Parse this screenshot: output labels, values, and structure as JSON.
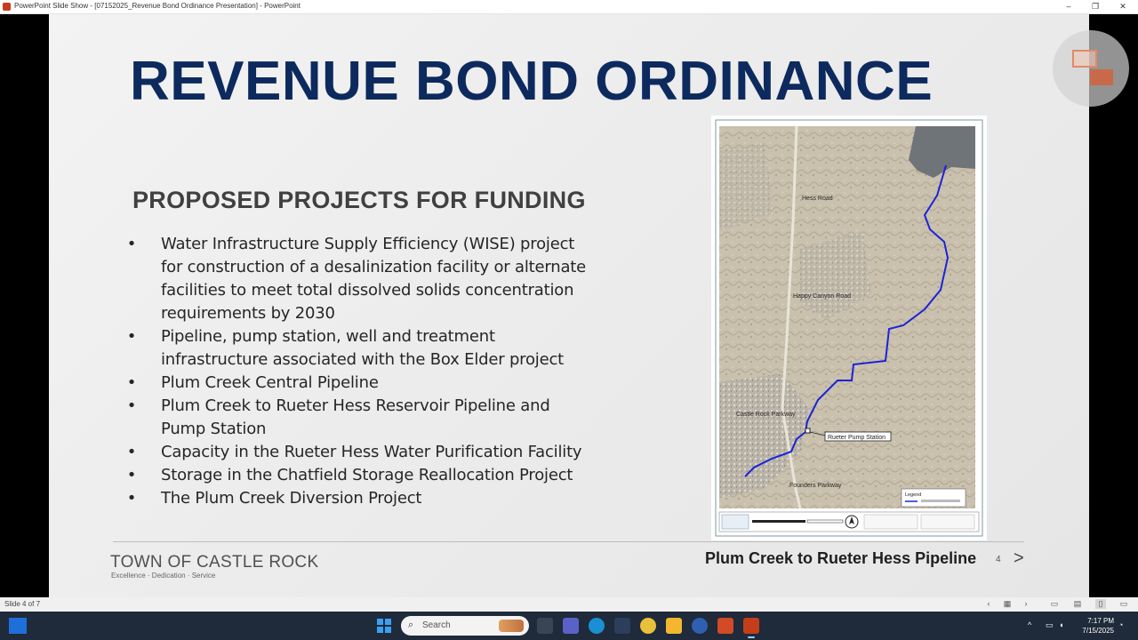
{
  "window": {
    "title": "PowerPoint Slide Show - [07152025_Revenue Bond Ordinance Presentation] - PowerPoint",
    "controls": [
      "–",
      "❐",
      "✕"
    ]
  },
  "slide": {
    "title": "REVENUE BOND ORDINANCE",
    "subtitle": "PROPOSED PROJECTS FOR FUNDING",
    "bullets": [
      "Water Infrastructure Supply Efficiency (WISE) project for construction of a desalinization facility or alternate facilities to meet total dissolved solids concentration requirements by 2030",
      "Pipeline, pump station, well and treatment infrastructure associated with the Box Elder project",
      "Plum Creek Central Pipeline",
      "Plum Creek to Rueter Hess Reservoir Pipeline and Pump Station",
      "Capacity in the Rueter Hess Water Purification Facility",
      "Storage in the Chatfield Storage Reallocation Project",
      "The Plum Creek Diversion Project"
    ],
    "bullet_glyph": "•",
    "map": {
      "labels": {
        "hess_road": "Hess Road",
        "happy_canyon": "Happy Canyon Road",
        "castle_rock_pkwy": "Castle Rock Parkway",
        "pump_station": "Rueter Pump Station",
        "founders": "Founders Parkway",
        "legend": "Legend"
      },
      "route_color": "#1a24d8"
    },
    "footer": {
      "org": "TOWN OF CASTLE ROCK",
      "tagline": "Excellence · Dedication · Service",
      "right_caption": "Plum Creek to Rueter Hess Pipeline",
      "slide_number": "4",
      "next_glyph": ">"
    }
  },
  "statusbar": {
    "slide_count": "Slide 4 of 7"
  },
  "taskbar": {
    "search_placeholder": "Search",
    "search_glyph": "⌕",
    "time": "7:17 PM",
    "date": "7/15/2025",
    "tray_up": "^"
  },
  "colors": {
    "title_blue": "#0d2a5e",
    "taskbar_bg": "#1f2a3a"
  }
}
